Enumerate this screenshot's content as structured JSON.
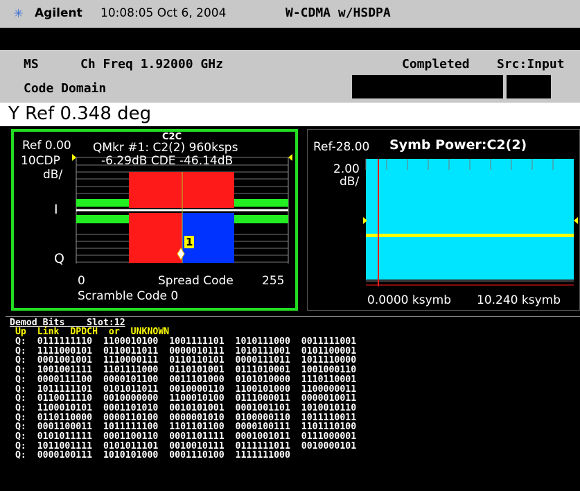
{
  "header": {
    "brand": "Agilent",
    "datetime": "10:08:05  Oct 6, 2004",
    "mode": "W-CDMA w/HSDPA"
  },
  "info": {
    "device": "MS",
    "ch_freq": "Ch Freq 1.92000 GHz",
    "status": "Completed",
    "source": "Src:Input",
    "measurement": "Code Domain"
  },
  "yref": "Y Ref  0.348 deg",
  "left_plot": {
    "ref": "Ref 0.00",
    "marker_line": "QMkr #1: C2(2) 960ksps",
    "marker_small": "C2C",
    "cdp_label": "10CDP",
    "cdp_value": "-6.29dB CDE  -46.14dB",
    "scale": "dB/",
    "i_label": "I",
    "q_label": "Q",
    "marker_num": "1",
    "x_start": "0",
    "x_label": "Spread Code",
    "x_end": "255",
    "scramble": "Scramble Code 0"
  },
  "right_plot": {
    "ref": "Ref-28.00",
    "title": "Symb Power:C2(2)",
    "scale_val": "2.00",
    "scale_unit": "dB/",
    "x_start": "0.0000 ksymb",
    "x_end": "10.240 ksymb"
  },
  "demod": {
    "header": "Demod Bits    Slot:12",
    "subheader": " Up  Link  DPDCH  or  UNKNOWN",
    "rows": [
      " Q:  0111111110  1100010100  1001111101  1010111000  0011111001",
      " Q:  1111000101  0110011011  0000010111  1010111001  0101100001",
      " Q:  0001001001  1110000111  0110110101  0000111011  1011110000",
      " Q:  1001001111  1101111000  0110101001  0111010001  1001000110",
      " Q:  0000111100  0000101100  0011101000  0101010000  1110110001",
      " Q:  1011111101  0101011011  0010000110  1100101000  1100000011",
      " Q:  0110011110  0010000000  1100010100  0111000011  0000010011",
      " Q:  1100010101  0001101010  0010101001  0001001101  1010010110",
      " Q:  0110110000  0000110100  0000001010  0100000110  1011110011",
      " Q:  0001100011  1011111100  1101101100  0000100111  1101110100",
      " Q:  0101011111  0001100110  0001101111  0001001011  0111000001",
      " Q:  1011001111  0101011101  0010010111  0111111011  0010000101",
      " Q:  0000100111  1010101000  0001110100  1111111000"
    ]
  },
  "colors": {
    "frame_active": "#22dd22",
    "bar_i": "#ff1a1a",
    "bar_q": "#0033ff",
    "symb_fill": "#00e5ff",
    "trace_yellow": "#ffff00"
  }
}
